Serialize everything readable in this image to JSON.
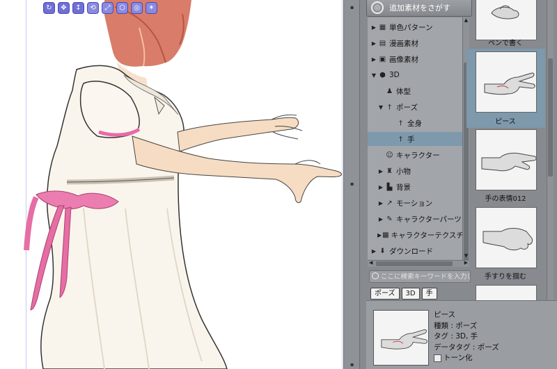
{
  "canvas": {
    "tool_icons": [
      "rotate-view-icon",
      "pan-camera-icon",
      "move-object-icon",
      "rotate-object-icon",
      "scale-object-icon",
      "transform-object-icon",
      "camera-icon",
      "lighting-icon"
    ]
  },
  "material_panel": {
    "search_more_label": "追加素材をさがす",
    "tree": [
      {
        "label": "単色パターン",
        "arrow": "▶",
        "icon": "pattern-icon",
        "indent": 1
      },
      {
        "label": "漫画素材",
        "arrow": "▶",
        "icon": "manga-material-icon",
        "indent": 1
      },
      {
        "label": "画像素材",
        "arrow": "▶",
        "icon": "image-material-icon",
        "indent": 1
      },
      {
        "label": "3D",
        "arrow": "▼",
        "icon": "3d-cube-icon",
        "indent": 1
      },
      {
        "label": "体型",
        "arrow": "",
        "icon": "body-shape-icon",
        "indent": 2
      },
      {
        "label": "ポーズ",
        "arrow": "▼",
        "icon": "pose-icon",
        "indent": 2
      },
      {
        "label": "全身",
        "arrow": "",
        "icon": "full-body-icon",
        "indent": 3
      },
      {
        "label": "手",
        "arrow": "",
        "icon": "hand-pose-icon",
        "indent": 3,
        "selected": true
      },
      {
        "label": "キャラクター",
        "arrow": "",
        "icon": "character-icon",
        "indent": 2
      },
      {
        "label": "小物",
        "arrow": "▶",
        "icon": "small-object-icon",
        "indent": 2
      },
      {
        "label": "背景",
        "arrow": "▶",
        "icon": "background-icon",
        "indent": 2
      },
      {
        "label": "モーション",
        "arrow": "▶",
        "icon": "motion-icon",
        "indent": 2
      },
      {
        "label": "キャラクターパーツ",
        "arrow": "▶",
        "icon": "character-parts-icon",
        "indent": 2
      },
      {
        "label": "キャラクターテクスチャ",
        "arrow": "▶",
        "icon": "character-texture-icon",
        "indent": 2
      },
      {
        "label": "ダウンロード",
        "arrow": "▶",
        "icon": "download-icon",
        "indent": 1
      }
    ],
    "search": {
      "placeholder": "ここに検索キーワードを入力してく"
    },
    "tags": [
      "ポーズ",
      "3D",
      "手"
    ],
    "thumbnails": [
      {
        "label": "ペンで書く"
      },
      {
        "label": "ピース",
        "selected": true
      },
      {
        "label": "手の表情012"
      },
      {
        "label": "手すりを掴む"
      }
    ],
    "detail": {
      "name": "ピース",
      "type": "種類 : ポーズ",
      "tags": "タグ : 3D, 手",
      "data_tags": "データタグ : ポーズ",
      "tone_label": "トーン化"
    }
  }
}
